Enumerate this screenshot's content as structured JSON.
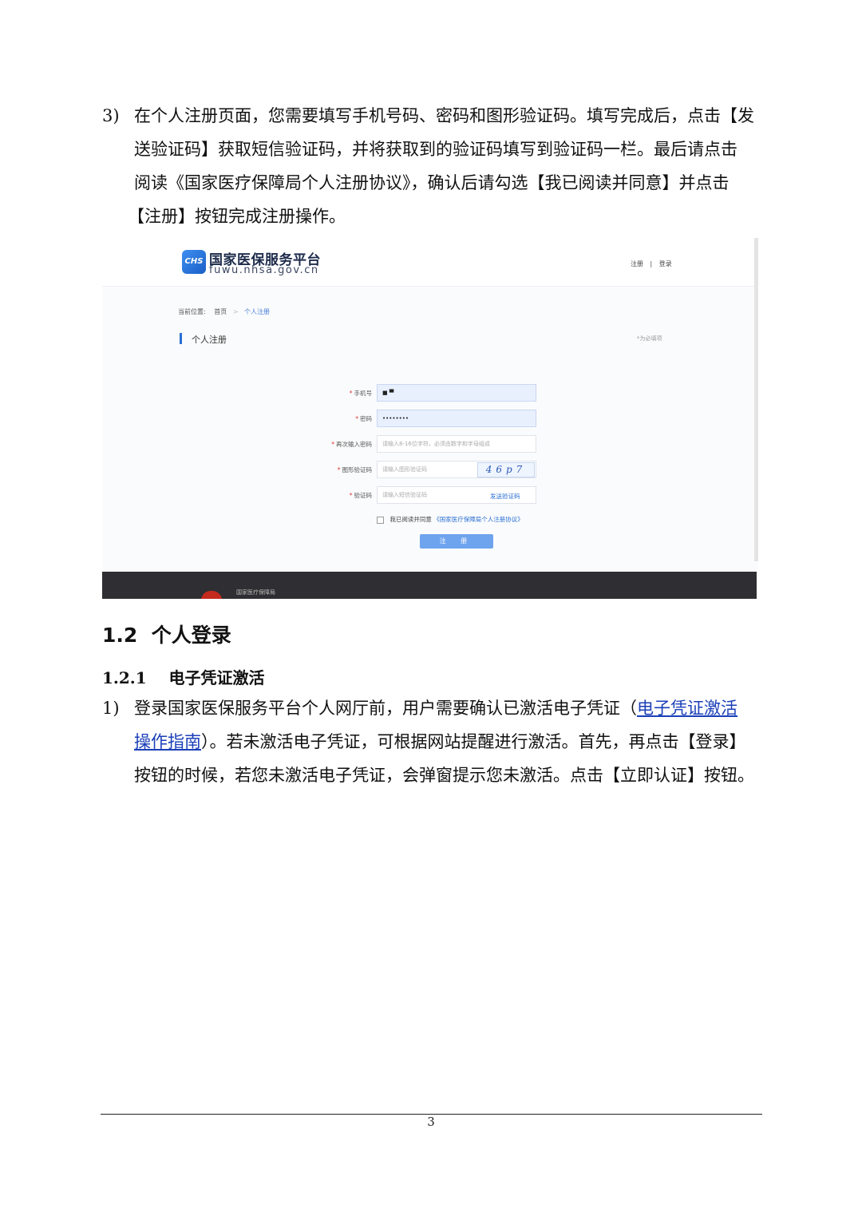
{
  "step3": {
    "number": "3)",
    "line1": "在个人注册页面，您需要填写手机号码、密码和图形验证码。填写完成后，点击【发",
    "line2": "送验证码】获取短信验证码，并将获取到的验证码填写到验证码一栏。最后请点击",
    "line3": "阅读《国家医疗保障局个人注册协议》，确认后请勾选【我已阅读并同意】并点击",
    "line4": "【注册】按钮完成注册操作。"
  },
  "screenshot": {
    "logo_mark": "CHS",
    "site_title": "国家医保服务平台",
    "site_url": "fuwu.nhsa.gov.cn",
    "nav_register": "注册",
    "nav_divider": "|",
    "nav_login": "登录",
    "breadcrumb_prefix": "当前位置:",
    "breadcrumb_home": "首页",
    "breadcrumb_sep": ">",
    "breadcrumb_current": "个人注册",
    "section_title": "个人注册",
    "required_note": "*为必填项",
    "fields": [
      {
        "label": "手机号",
        "value": "■ ▀",
        "placeholder": ""
      },
      {
        "label": "密码",
        "value": "••••••••",
        "placeholder": ""
      },
      {
        "label": "再次输入密码",
        "value": "",
        "placeholder": "请输入8-16位字符，必须由数字和字母组成"
      },
      {
        "label": "图形验证码",
        "value": "",
        "placeholder": "请输入图形验证码"
      },
      {
        "label": "验证码",
        "value": "",
        "placeholder": "请输入短信验证码"
      }
    ],
    "captcha_text": "46p7",
    "send_code_label": "发送验证码",
    "agree_prefix": "我已阅读并同意",
    "agree_link": "《国家医疗保障局个人注册协议》",
    "submit_label": "注 册",
    "footer_text": "国家医疗保障局"
  },
  "section_1_2": "1.2  个人登录",
  "section_1_2_1": "1.2.1    电子凭证激活",
  "step1": {
    "number": "1)",
    "line1_text": "登录国家医保服务平台个人网厅前，用户需要确认已激活电子凭证（",
    "line1_link": "电子凭证激活",
    "line2_link": "操作指南",
    "line2_text": "）。若未激活电子凭证，可根据网站提醒进行激活。首先，再点击【登录】",
    "line3": "按钮的时候，若您未激活电子凭证，会弹窗提示您未激活。点击【立即认证】按钮。"
  },
  "page_number": "3"
}
